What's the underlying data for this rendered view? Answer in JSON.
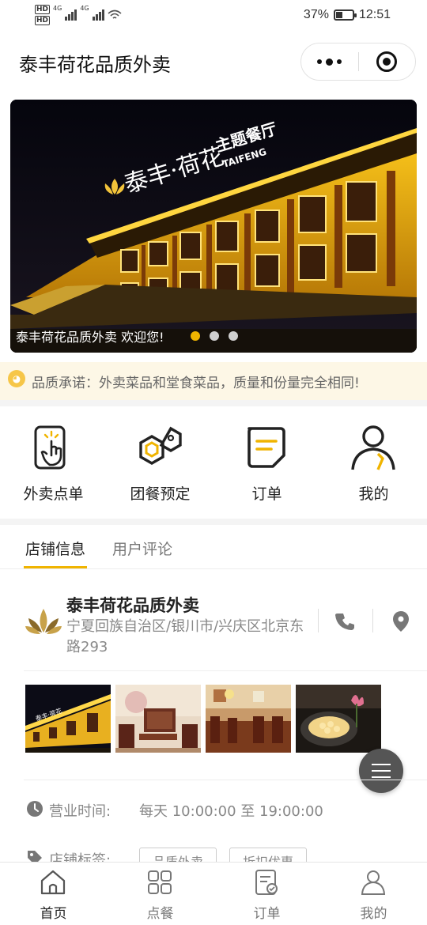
{
  "status_bar": {
    "hd_badge_1": "HD",
    "hd_badge_2": "HD",
    "network_1": "4G",
    "network_2": "4G",
    "battery_percent": "37%",
    "time": "12:51"
  },
  "header": {
    "title": "泰丰荷花品质外卖"
  },
  "banner": {
    "caption": "泰丰荷花品质外卖 欢迎您!",
    "slide_count": 3,
    "active_slide": 0,
    "sign_main": "泰丰·荷花",
    "sign_sub": "主题餐厅",
    "sign_en": "TAIFENG"
  },
  "notice": {
    "text": "品质承诺：外卖菜品和堂食菜品，质量和份量完全相同!"
  },
  "quick_menu": [
    {
      "label": "外卖点单",
      "icon": "tap-order-icon"
    },
    {
      "label": "团餐预定",
      "icon": "group-meal-icon"
    },
    {
      "label": "订单",
      "icon": "order-icon"
    },
    {
      "label": "我的",
      "icon": "user-icon"
    }
  ],
  "tabs": {
    "store_info": "店铺信息",
    "reviews": "用户评论",
    "active": "store_info"
  },
  "store": {
    "name": "泰丰荷花品质外卖",
    "address": "宁夏回族自治区/银川市/兴庆区北京东路293"
  },
  "info": {
    "hours_label": "营业时间:",
    "hours_value": "每天 10:00:00 至 19:00:00",
    "tags_label": "店铺标签:",
    "tags": [
      "品质外卖",
      "折扣优惠"
    ]
  },
  "bottom_nav": [
    {
      "label": "首页",
      "icon": "home-icon",
      "active": true
    },
    {
      "label": "点餐",
      "icon": "grid-icon",
      "active": false
    },
    {
      "label": "订单",
      "icon": "order-check-icon",
      "active": false
    },
    {
      "label": "我的",
      "icon": "user-icon",
      "active": false
    }
  ],
  "colors": {
    "accent": "#f0b400",
    "notice_bg": "#fdf7e6",
    "text_primary": "#222222",
    "text_secondary": "#888888"
  }
}
